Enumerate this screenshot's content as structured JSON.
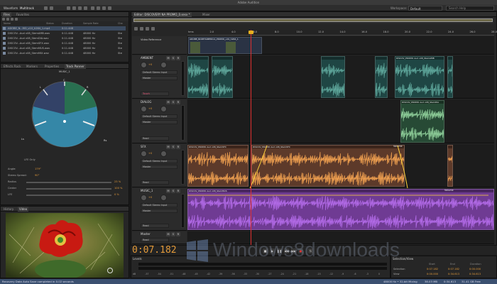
{
  "app": {
    "title": "Adobe Audition"
  },
  "toolbar": {
    "waveform_label": "Waveform",
    "multitrack_label": "Multitrack",
    "workspace_label": "Workspace:",
    "workspace_value": "Default",
    "search_placeholder": "Search Help"
  },
  "files_panel": {
    "tabs": [
      "Files",
      "Favorites"
    ],
    "columns": [
      "Name",
      "Status",
      "Duration",
      "Sample Rate",
      "Cha"
    ],
    "rows": [
      {
        "name": "ADOBE_N...MO_v10_h264_1.mp4",
        "duration": "0:11.448",
        "rate": "",
        "ch": ""
      },
      {
        "name": "DISCOV...Aud v08_StemAMB.wav",
        "duration": "0:11.448",
        "rate": "48000 Hz",
        "ch": "Ste"
      },
      {
        "name": "DISCOV...Aud v08_StemDIA.wav",
        "duration": "0:11.448",
        "rate": "48000 Hz",
        "ch": "Ste"
      },
      {
        "name": "DISCOV...Aud v08_StemSFX.wav",
        "duration": "0:11.448",
        "rate": "48000 Hz",
        "ch": "Ste"
      },
      {
        "name": "DISCOV...Aud v08_StemMUS.wav",
        "duration": "0:11.448",
        "rate": "48000 Hz",
        "ch": "Ste"
      },
      {
        "name": "DISCOV...Aud v08_StemMIX.wav",
        "duration": "0:11.448",
        "rate": "48000 Hz",
        "ch": "Ste"
      }
    ]
  },
  "panner_panel": {
    "tabs": [
      "Effects Rack",
      "Markers",
      "Properties",
      "Track Panner"
    ],
    "track": "MUSIC_1",
    "labels": {
      "c": "C",
      "l": "L",
      "r": "R",
      "ls": "Ls",
      "rs": "Rs",
      "lfe": "LFE Only"
    },
    "params": [
      {
        "label": "Angle:",
        "value": "179°"
      },
      {
        "label": "Stereo Spread:",
        "value": "90°"
      },
      {
        "label": "Radius",
        "value": "23 %"
      },
      {
        "label": "Center",
        "value": "100 %"
      },
      {
        "label": "LFE",
        "value": "0 %"
      }
    ]
  },
  "history_panel": {
    "tabs": [
      "History",
      "Video"
    ]
  },
  "status": {
    "left": "Recovery Data Auto Save completed in 0.02 seconds"
  },
  "editor": {
    "tabs": [
      "Editor: DISCOVERY NA PROMO_0.sesx *",
      "Mixer"
    ],
    "ruler": [
      "hms",
      "2.0",
      "4.0",
      "6.0",
      "8.0",
      "10.0",
      "12.0",
      "14.0",
      "16.0",
      "18.0",
      "20.0",
      "22.0",
      "24.0",
      "26.0",
      "28.0"
    ],
    "video_ref": "Video Reference",
    "video_clip": "ADOBE_NORTHAMERICA_PROMO_v10_h264_1",
    "tracks": [
      {
        "name": "AMBIENT",
        "input": "Default Stereo Input",
        "output": "Master",
        "mode": "Touch",
        "vol": "+0",
        "clip_label": "DISCOV_PROMO Aud v08_StemAMB"
      },
      {
        "name": "DIALOG",
        "input": "Default Stereo Input",
        "output": "Master",
        "mode": "Read",
        "vol": "+0",
        "clip_label": "DISCOV_PROMO Aud v08_StemDIA"
      },
      {
        "name": "SFX",
        "input": "Default Stereo Input",
        "output": "Master",
        "mode": "Read",
        "vol": "+0",
        "clip_label": "DISCOV_PROMO Aud v08_StemSFX",
        "volume_label": "Volume"
      },
      {
        "name": "MUSIC_1",
        "input": "Default Stereo Input",
        "output": "Master",
        "mode": "Read",
        "vol": "+0",
        "clip_label": "DISCOV_PROMO Aud v08_StemMUS",
        "volume_label": "Volume"
      },
      {
        "name": "Master",
        "input": "",
        "output": "",
        "mode": "Read",
        "vol": ""
      }
    ],
    "timecode": "0:07.182"
  },
  "levels": {
    "title": "Levels",
    "scale": [
      "dB",
      "-57",
      "-54",
      "-51",
      "-48",
      "-45",
      "-42",
      "-39",
      "-36",
      "-33",
      "-30",
      "-27",
      "-24",
      "-21",
      "-18",
      "-15",
      "-12",
      "-9",
      "-6",
      "-3",
      "0"
    ]
  },
  "selection": {
    "title": "Selection/View",
    "headers": [
      "Start",
      "End",
      "Duration"
    ],
    "selection": [
      "0:07.182",
      "0:07.182",
      "0:00.000"
    ],
    "view": [
      "0:00.000",
      "0:34.613",
      "0:34.613"
    ]
  },
  "footer": {
    "rate": "48000 Hz • 32-bit Mixing",
    "mem": "38.03 MB",
    "dur": "0:34.613",
    "free": "31.41 GB Free"
  },
  "watermark": "Windows8downloads",
  "colors": {
    "accent": "#e39a3a",
    "ambient": "#1f4644",
    "dialog": "#274a35",
    "sfx": "#5d3a2a",
    "music": "#6f3b93",
    "wave_teal": "#5fa89c",
    "wave_green": "#8fcf9a",
    "wave_orange": "#f0a050",
    "wave_purple": "#b36be8"
  }
}
